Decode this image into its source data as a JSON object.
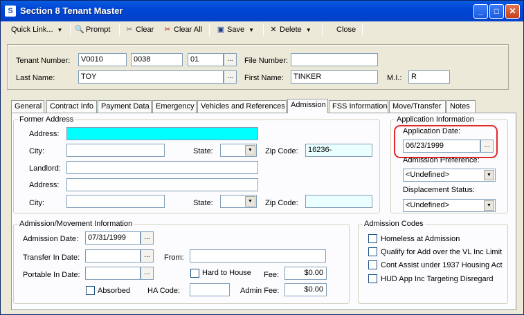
{
  "window": {
    "title": "Section 8 Tenant Master"
  },
  "toolbar": {
    "quick_link": "Quick Link...",
    "prompt": "Prompt",
    "clear": "Clear",
    "clear_all": "Clear All",
    "save": "Save",
    "delete": "Delete",
    "close": "Close"
  },
  "header": {
    "tenant_number_label": "Tenant Number:",
    "tenant_number_1": "V0010",
    "tenant_number_2": "0038",
    "tenant_number_3": "01",
    "file_number_label": "File Number:",
    "file_number": "",
    "last_name_label": "Last Name:",
    "last_name": "TOY",
    "first_name_label": "First Name:",
    "first_name": "TINKER",
    "mi_label": "M.I.:",
    "mi": "R"
  },
  "tabs": [
    {
      "label": "General"
    },
    {
      "label": "Contract Info"
    },
    {
      "label": "Payment Data"
    },
    {
      "label": "Emergency"
    },
    {
      "label": "Vehicles and References"
    },
    {
      "label": "Admission"
    },
    {
      "label": "FSS Information"
    },
    {
      "label": "Move/Transfer"
    },
    {
      "label": "Notes"
    }
  ],
  "former_address": {
    "title": "Former Address",
    "address_label": "Address:",
    "address": "",
    "city_label": "City:",
    "city": "",
    "state_label": "State:",
    "state": "",
    "zip_label": "Zip Code:",
    "zip": "16236-",
    "landlord_label": "Landlord:",
    "landlord": "",
    "address2_label": "Address:",
    "address2": "",
    "city2_label": "City:",
    "city2": "",
    "state2_label": "State:",
    "state2": "",
    "zip2_label": "Zip Code:",
    "zip2": ""
  },
  "application_info": {
    "title": "Application Information",
    "application_date_label": "Application Date:",
    "application_date": "06/23/1999",
    "admission_preference_label": "Admission Preference:",
    "admission_preference": "<Undefined>",
    "displacement_status_label": "Displacement Status:",
    "displacement_status": "<Undefined>"
  },
  "admission_movement": {
    "title": "Admission/Movement Information",
    "admission_date_label": "Admission Date:",
    "admission_date": "07/31/1999",
    "transfer_in_label": "Transfer In Date:",
    "transfer_in": "",
    "from_label": "From:",
    "from": "",
    "hard_to_house_label": "Hard to House",
    "portable_in_label": "Portable In Date:",
    "portable_in": "",
    "fee_label": "Fee:",
    "fee": "$0.00",
    "absorbed_label": "Absorbed",
    "ha_code_label": "HA Code:",
    "ha_code": "",
    "admin_fee_label": "Admin Fee:",
    "admin_fee": "$0.00"
  },
  "admission_codes": {
    "title": "Admission Codes",
    "items": [
      {
        "label": "Homeless at Admission"
      },
      {
        "label": "Qualify for Add over the VL Inc Limit"
      },
      {
        "label": "Cont Assist under 1937 Housing Act"
      },
      {
        "label": "HUD App Inc Targeting Disregard"
      }
    ]
  },
  "icons": {
    "ellipsis": "...",
    "dropdown": "▼"
  },
  "colors": {
    "titlebar": "#0046d5",
    "required_field": "#00ffff",
    "highlight": "#e3262a"
  }
}
